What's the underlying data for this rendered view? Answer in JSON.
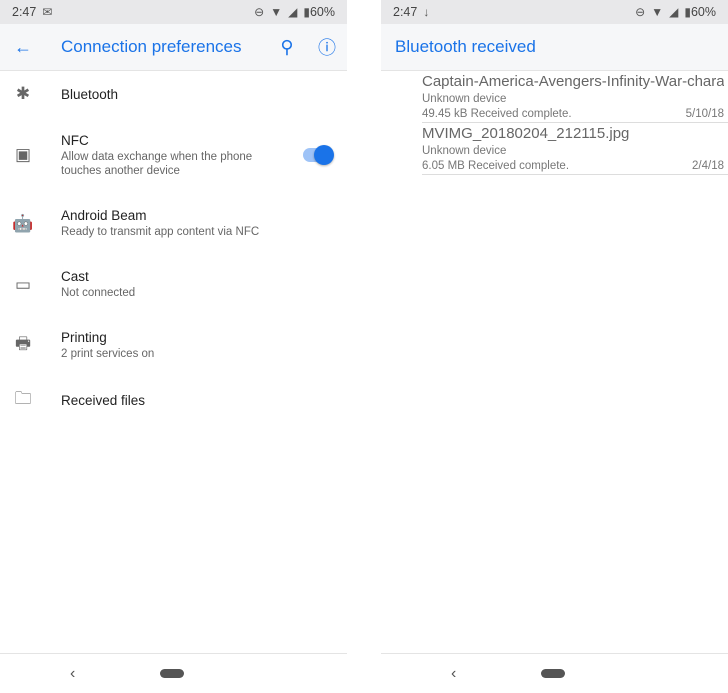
{
  "left": {
    "status": {
      "time": "2:47",
      "battery": "60%"
    },
    "title": "Connection preferences",
    "items": [
      {
        "icon": "bluetooth-icon",
        "glyph": "✱",
        "title": "Bluetooth"
      },
      {
        "icon": "nfc-icon",
        "glyph": "▣",
        "title": "NFC",
        "subtitle": "Allow data exchange when the phone touches another device",
        "toggle": true
      },
      {
        "icon": "android-icon",
        "glyph": "🤖",
        "title": "Android Beam",
        "subtitle": "Ready to transmit app content via NFC"
      },
      {
        "icon": "cast-icon",
        "glyph": "▭",
        "title": "Cast",
        "subtitle": "Not connected"
      },
      {
        "icon": "printer-icon",
        "glyph": "🖶",
        "title": "Printing",
        "subtitle": "2 print services on"
      },
      {
        "icon": "folder-icon",
        "glyph": "🗀",
        "title": "Received files"
      }
    ]
  },
  "right": {
    "status": {
      "time": "2:47",
      "battery": "60%"
    },
    "title": "Bluetooth received",
    "files": [
      {
        "name": "Captain-America-Avengers-Infinity-War-chara",
        "device": "Unknown device",
        "status": "49.45 kB Received complete.",
        "date": "5/10/18"
      },
      {
        "name": "MVIMG_20180204_212115.jpg",
        "device": "Unknown device",
        "status": "6.05 MB Received complete.",
        "date": "2/4/18"
      }
    ]
  }
}
